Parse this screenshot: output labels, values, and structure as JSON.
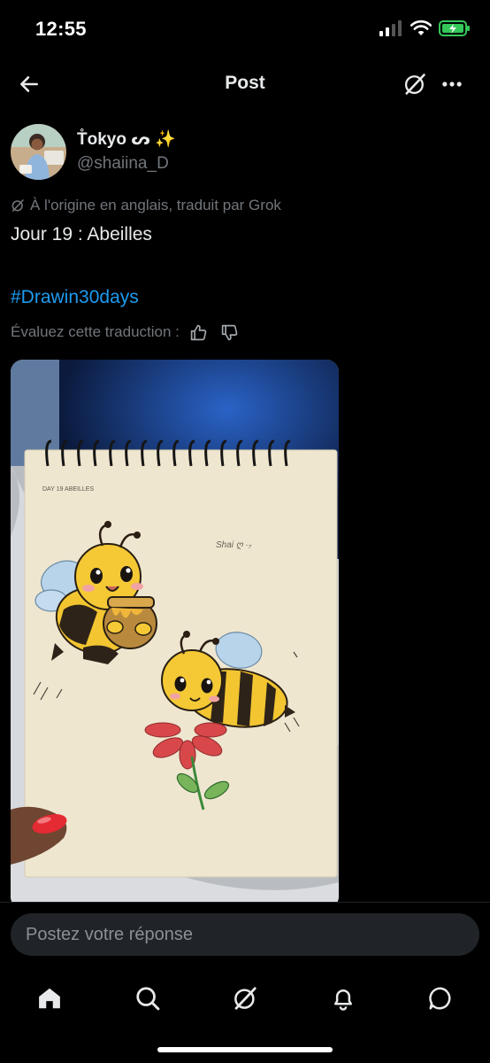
{
  "status_bar": {
    "time": "12:55"
  },
  "header": {
    "title": "Post"
  },
  "author": {
    "display_name": "T̊okyo ᔕ ✨",
    "handle": "@shaiina_D"
  },
  "post": {
    "translation_note": "À l'origine en anglais, traduit par Grok",
    "text": "Jour 19 : Abeilles",
    "hashtag": "#Drawin30days",
    "rate_label": "Évaluez cette traduction :"
  },
  "media": {
    "caption": "DAY 19   ABEILLES"
  },
  "reply": {
    "placeholder": "Postez votre réponse"
  },
  "tabs": [
    "home-icon",
    "search-icon",
    "grok-icon",
    "bell-icon",
    "messages-icon"
  ],
  "colors": {
    "accent": "#1d9bf0",
    "muted": "#71767b",
    "battery": "#34c759",
    "input_bg": "#202327"
  }
}
